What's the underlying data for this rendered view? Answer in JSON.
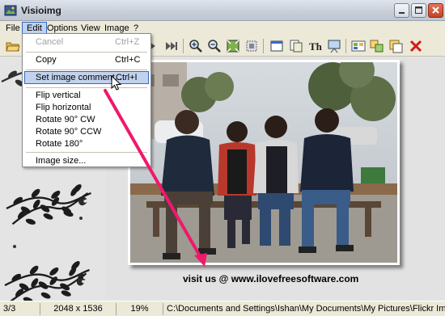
{
  "window": {
    "title": "Visioimg"
  },
  "menubar": {
    "items": [
      "File",
      "Edit",
      "Options",
      "View",
      "Image",
      "?"
    ]
  },
  "edit_menu": {
    "cancel_label": "Cancel",
    "cancel_shortcut": "Ctrl+Z",
    "copy_label": "Copy",
    "copy_shortcut": "Ctrl+C",
    "comment_label": "Set image comment...",
    "comment_shortcut": "Ctrl+I",
    "flip_vertical": "Flip vertical",
    "flip_horizontal": "Flip horizontal",
    "rotate_cw": "Rotate 90° CW",
    "rotate_ccw": "Rotate 90° CCW",
    "rotate_180": "Rotate 180°",
    "image_size": "Image size..."
  },
  "canvas": {
    "caption": "visit us @ www.ilovefreesoftware.com"
  },
  "statusbar": {
    "index": "3/3",
    "dimensions": "2048 x 1536",
    "zoom": "19%",
    "path": "C:\\Documents and Settings\\Ishan\\My Documents\\My Pictures\\Flickr Images\\ILI"
  },
  "colors": {
    "accent_arrow": "#f0186c",
    "menu_highlight": "#c1d2ee",
    "close_button": "#c44324"
  },
  "icons": [
    "open-folder-icon",
    "next-icon",
    "last-icon",
    "zoom-in-icon",
    "zoom-out-icon",
    "fit-icon",
    "actual-size-icon",
    "window-icon",
    "copy-icon",
    "thumbnails-icon",
    "slideshow-icon",
    "gallery-icon",
    "convert-icon",
    "batch-icon",
    "delete-icon"
  ]
}
